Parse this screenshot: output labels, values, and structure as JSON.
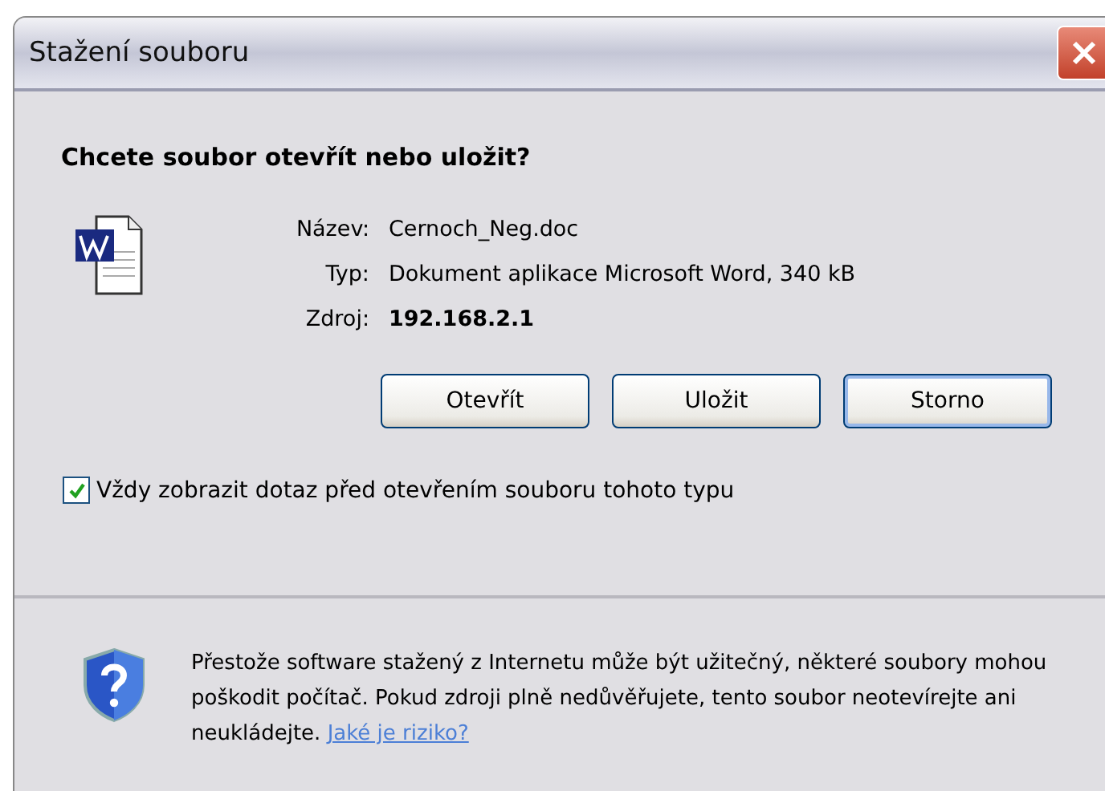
{
  "window": {
    "title": "Stažení souboru"
  },
  "question": "Chcete soubor otevřít nebo uložit?",
  "file_info": [
    {
      "label": "Název:",
      "value": "Cernoch_Neg.doc",
      "bold": false
    },
    {
      "label": "Typ:",
      "value": "Dokument aplikace Microsoft Word, 340 kB",
      "bold": false
    },
    {
      "label": "Zdroj:",
      "value": "192.168.2.1",
      "bold": true
    }
  ],
  "buttons": [
    {
      "label": "Otevřít",
      "focused": false
    },
    {
      "label": "Uložit",
      "focused": false
    },
    {
      "label": "Storno",
      "focused": true
    }
  ],
  "always_ask": {
    "label": "Vždy zobrazit dotaz před otevřením souboru tohoto typu",
    "checked": true
  },
  "warning": {
    "text": "Přestože software stažený z Internetu může být užitečný, některé soubory mohou poškodit počítač. Pokud zdroji plně nedůvěřujete, tento soubor neotevírejte ani neukládejte.",
    "link": "Jaké je riziko?"
  }
}
